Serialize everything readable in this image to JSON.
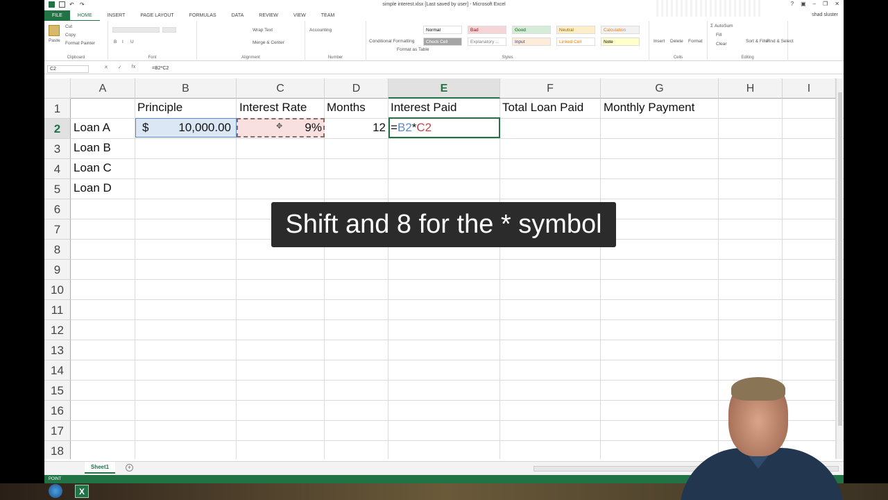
{
  "window": {
    "title": "simple interest.xlsx [Last saved by user] - Microsoft Excel",
    "user": "shad sluster"
  },
  "ribbon_tabs": [
    "FILE",
    "HOME",
    "INSERT",
    "PAGE LAYOUT",
    "FORMULAS",
    "DATA",
    "REVIEW",
    "VIEW",
    "TEAM"
  ],
  "ribbon": {
    "clipboard": {
      "paste": "Paste",
      "cut": "Cut",
      "copy": "Copy",
      "format_painter": "Format Painter",
      "label": "Clipboard"
    },
    "font": {
      "label": "Font"
    },
    "alignment": {
      "wrap_text": "Wrap Text",
      "merge_center": "Merge & Center",
      "label": "Alignment"
    },
    "number": {
      "format": "Accounting",
      "label": "Number"
    },
    "styles": {
      "conditional": "Conditional Formatting",
      "format_table": "Format as Table",
      "items": [
        "Normal",
        "Bad",
        "Good",
        "Neutral",
        "Calculation",
        "Check Cell",
        "Explanatory ...",
        "Input",
        "Linked Cell",
        "Note"
      ],
      "label": "Styles"
    },
    "cells": {
      "insert": "Insert",
      "delete": "Delete",
      "format": "Format",
      "label": "Cells"
    },
    "editing": {
      "autosum": "AutoSum",
      "fill": "Fill",
      "clear": "Clear",
      "sort_filter": "Sort & Filter",
      "find_select": "Find & Select",
      "label": "Editing"
    }
  },
  "formula_bar": {
    "name_box": "C2",
    "fx": "fx",
    "formula": "=B2*C2"
  },
  "columns": [
    "A",
    "B",
    "C",
    "D",
    "E",
    "F",
    "G",
    "H",
    "I"
  ],
  "rows": [
    "1",
    "2",
    "3",
    "4",
    "5",
    "6",
    "7",
    "8",
    "9",
    "10",
    "11",
    "12",
    "13",
    "14",
    "15",
    "16",
    "17",
    "18"
  ],
  "cells": {
    "B1": "Principle",
    "C1": "Interest Rate",
    "D1": "Months",
    "E1": "Interest Paid",
    "F1": "Total Loan Paid",
    "G1": "Monthly Payment",
    "A2": "Loan A",
    "B2_symbol": "$",
    "B2_value": "10,000.00",
    "C2": "9%",
    "D2": "12",
    "E2_eq": "=",
    "E2_ref1": "B2",
    "E2_op": "*",
    "E2_ref2": "C2",
    "A3": "Loan B",
    "A4": "Loan C",
    "A5": "Loan D"
  },
  "caption": "Shift and 8 for the * symbol",
  "sheet_tabs": [
    "Sheet1"
  ],
  "status": "POINT",
  "colors": {
    "accent": "#217346",
    "ref_blue": "#5b8bc9",
    "ref_red": "#c04a4a"
  }
}
